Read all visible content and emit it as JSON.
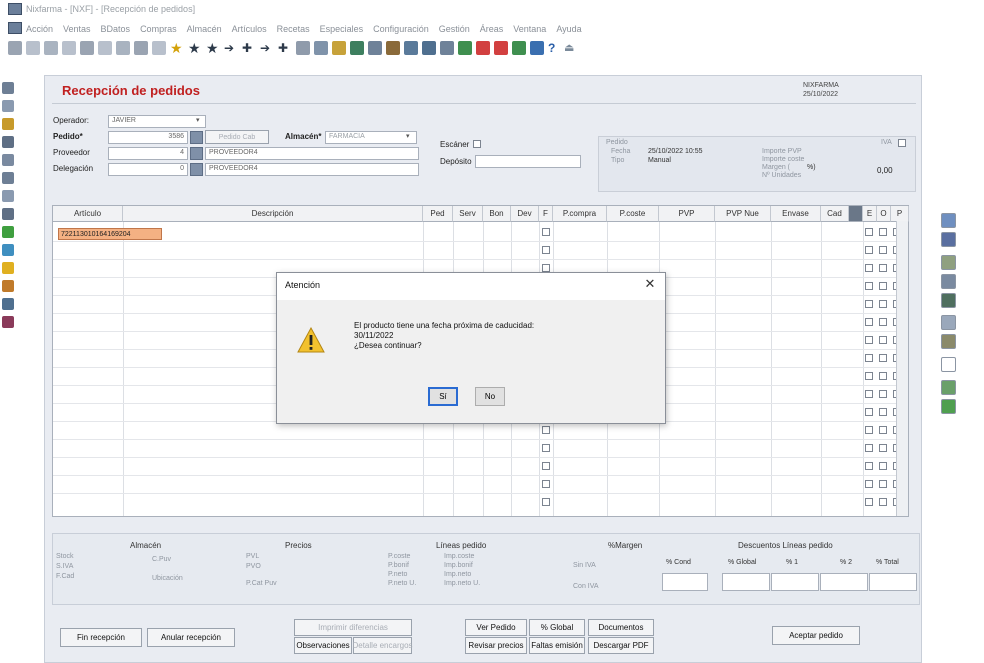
{
  "window": {
    "title": "Nixfarma - [NXF] - [Recepción de pedidos]"
  },
  "menu": [
    "Acción",
    "Ventas",
    "BDatos",
    "Compras",
    "Almacén",
    "Artículos",
    "Recetas",
    "Especiales",
    "Configuración",
    "Gestión",
    "Áreas",
    "Ventana",
    "Ayuda"
  ],
  "form": {
    "title": "Recepción de pedidos",
    "company": "NIXFARMA",
    "date": "25/10/2022",
    "operador_label": "Operador:",
    "operador_value": "JAVIER",
    "pedido_label": "Pedido*",
    "pedido_value": "3586",
    "pedido_btn": "Pedido Cab",
    "almacen_label": "Almacén*",
    "almacen_value": "FARMACIA",
    "proveedor_label": "Proveedor",
    "proveedor_code": "4",
    "proveedor_name": "PROVEEDOR4",
    "delegacion_label": "Delegación",
    "delegacion_code": "0",
    "delegacion_name": "PROVEEDOR4",
    "escaner_label": "Escáner",
    "deposito_label": "Depósito"
  },
  "info": {
    "pedido_label": "Pedido",
    "fecha_label": "Fecha",
    "fecha_value": "25/10/2022 10:55",
    "tipo_label": "Tipo",
    "tipo_value": "Manual",
    "importe_pvp_label": "Importe PVP",
    "importe_coste_label": "Importe coste",
    "margen_label": "Margen (",
    "margen_unit": "%)",
    "num_unidades_label": "Nº Unidades",
    "margen_value": "0,00",
    "iva_label": "IVA"
  },
  "grid": {
    "headers": [
      "Artículo",
      "Descripción",
      "Ped",
      "Serv",
      "Bon",
      "Dev",
      "F",
      "P.compra",
      "P.coste",
      "PVP",
      "PVP Nue",
      "Envase",
      "Cad",
      "",
      "E",
      "O",
      "P"
    ],
    "first_row_code": "722113010164169204"
  },
  "dialog": {
    "title": "Atención",
    "line1": "El producto tiene una fecha próxima de caducidad:",
    "line2": "30/11/2022",
    "line3": "¿Desea continuar?",
    "yes": "Sí",
    "no": "No"
  },
  "bottom": {
    "almacen": "Almacén",
    "stock": "Stock",
    "stock_iva": "S.IVA",
    "fcad": "F.Cad",
    "cpuv": "C.Puv",
    "ubicacion": "Ubicación",
    "precios": "Precios",
    "pvl": "PVL",
    "pvo": "PVO",
    "pcatpuv": "P.Cat Puv",
    "lineas": "Líneas pedido",
    "pcoste": "P.coste",
    "pbonif": "P.bonif",
    "pneto": "P.neto",
    "pneto_u": "P.neto U.",
    "imp_coste": "Imp.coste",
    "imp_bonif": "Imp.bonif",
    "imp_neto": "Imp.neto",
    "imp_neto_u": "Imp.neto U.",
    "margen": "%Margen",
    "sin_iva": "Sin IVA",
    "con_iva": "Con IVA",
    "descuentos": "Descuentos Líneas pedido",
    "cond": "% Cond",
    "global": "% Global",
    "pct1": "% 1",
    "pct2": "% 2",
    "total": "% Total"
  },
  "buttons": {
    "fin": "Fin recepción",
    "anular": "Anular recepción",
    "imprimir": "Imprimir diferencias",
    "observaciones": "Observaciones",
    "detalle": "Detalle encargos",
    "ver_pedido": "Ver Pedido",
    "revisar": "Revisar precios",
    "global": "% Global",
    "faltas": "Faltas emisión",
    "documentos": "Documentos",
    "descargar": "Descargar PDF",
    "aceptar": "Aceptar pedido"
  },
  "colors": {
    "title_red": "#c02020",
    "selected_cell": "#f4b183",
    "dialog_focus": "#2a6bd2"
  }
}
